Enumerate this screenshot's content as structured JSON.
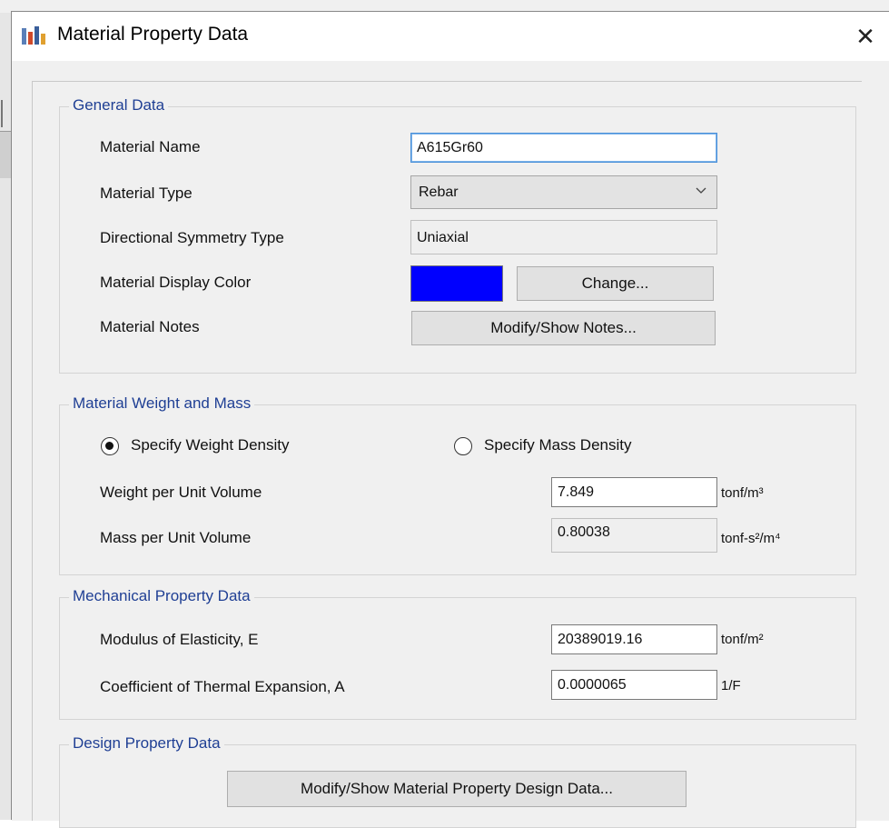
{
  "window": {
    "title": "Material Property Data",
    "close_glyph": "✕"
  },
  "general": {
    "title": "General Data",
    "material_name_label": "Material Name",
    "material_name_value": "A615Gr60",
    "material_type_label": "Material Type",
    "material_type_value": "Rebar",
    "symmetry_label": "Directional Symmetry Type",
    "symmetry_value": "Uniaxial",
    "display_color_label": "Material Display Color",
    "display_color": "#0000ff",
    "change_button": "Change...",
    "notes_label": "Material Notes",
    "notes_button": "Modify/Show Notes..."
  },
  "weight_mass": {
    "title": "Material Weight and Mass",
    "radio_weight": "Specify Weight Density",
    "radio_mass": "Specify Mass Density",
    "selected": "weight",
    "weight_label": "Weight per Unit Volume",
    "weight_value": "7.849",
    "weight_unit": "tonf/m³",
    "mass_label": "Mass per Unit Volume",
    "mass_value": "0.80038",
    "mass_unit": "tonf-s²/m⁴"
  },
  "mechanical": {
    "title": "Mechanical Property Data",
    "modulus_label": "Modulus of Elasticity,  E",
    "modulus_value": "20389019.16",
    "modulus_unit": "tonf/m²",
    "thermal_label": "Coefficient of Thermal Expansion,  A",
    "thermal_value": "0.0000065",
    "thermal_unit": "1/F"
  },
  "design": {
    "title": "Design Property Data",
    "design_button": "Modify/Show Material Property Design Data..."
  },
  "icons": {
    "app": "etabs-app-icon",
    "dropdown": "chevron-down-icon",
    "close": "close-icon"
  }
}
